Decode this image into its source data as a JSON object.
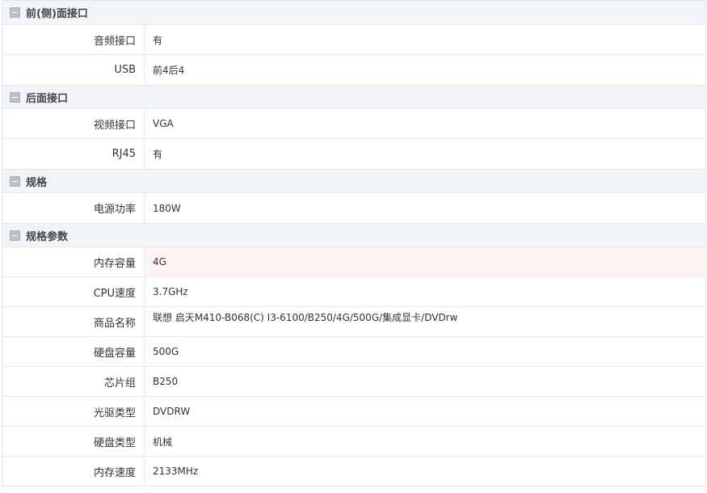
{
  "groups": [
    {
      "title": "前(侧)面接口",
      "rows": [
        {
          "label": "音频接口",
          "value": "有"
        },
        {
          "label": "USB",
          "value": "前4后4"
        }
      ]
    },
    {
      "title": "后面接口",
      "rows": [
        {
          "label": "视频接口",
          "value": "VGA"
        },
        {
          "label": "RJ45",
          "value": "有"
        }
      ]
    },
    {
      "title": "规格",
      "rows": [
        {
          "label": "电源功率",
          "value": "180W"
        }
      ]
    },
    {
      "title": "规格参数",
      "rows": [
        {
          "label": "内存容量",
          "value": "4G"
        },
        {
          "label": "CPU速度",
          "value": "3.7GHz"
        },
        {
          "label": "商品名称",
          "value": "联想 启天M410-B068(C) I3-6100/B250/4G/500G/集成显卡/DVDrw"
        },
        {
          "label": "硬盘容量",
          "value": "500G"
        },
        {
          "label": "芯片组",
          "value": "B250"
        },
        {
          "label": "光驱类型",
          "value": "DVDRW"
        },
        {
          "label": "硬盘类型",
          "value": "机械"
        },
        {
          "label": "内存速度",
          "value": "2133MHz"
        }
      ]
    }
  ],
  "icons": {
    "group_toggle": "minus-square-icon"
  },
  "colors": {
    "header_bg": "#f1f5fa",
    "highlight_row_bg": "#fdf3f2",
    "icon_bg": "#b9c0c9",
    "border": "#e6e9ee"
  }
}
